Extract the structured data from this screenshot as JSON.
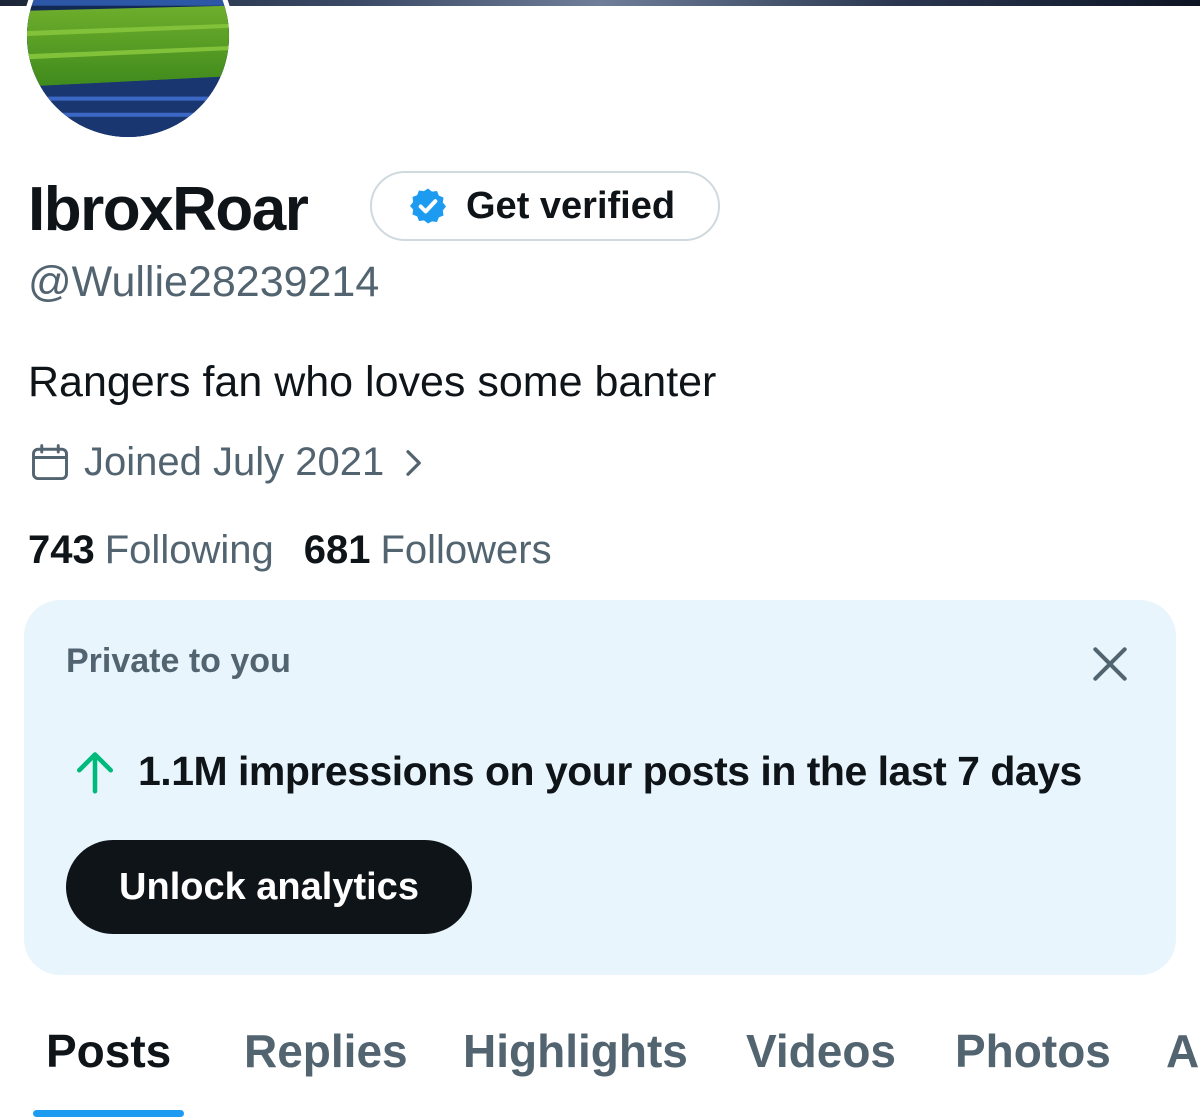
{
  "profile": {
    "display_name": "IbroxRoar",
    "verify_label": "Get verified",
    "handle": "@Wullie28239214",
    "bio": "Rangers fan who loves some banter",
    "joined": "Joined July 2021",
    "following_count": "743",
    "following_label": "Following",
    "followers_count": "681",
    "followers_label": "Followers"
  },
  "private_card": {
    "label": "Private to you",
    "impressions_text": "1.1M impressions on your posts in the last 7 days",
    "unlock_label": "Unlock analytics"
  },
  "tabs": [
    {
      "label": "Posts",
      "active": true
    },
    {
      "label": "Replies",
      "active": false
    },
    {
      "label": "Highlights",
      "active": false
    },
    {
      "label": "Videos",
      "active": false
    },
    {
      "label": "Photos",
      "active": false
    },
    {
      "label": "A",
      "active": false
    }
  ],
  "colors": {
    "accent": "#1d9bf0",
    "card_bg": "#e8f5fd",
    "muted_text": "#536471",
    "up_arrow": "#00ba7c"
  },
  "icons": {
    "verified": "verified-badge-icon",
    "calendar": "calendar-icon",
    "chevron": "chevron-right-icon",
    "close": "close-icon",
    "arrow": "arrow-up-icon"
  }
}
